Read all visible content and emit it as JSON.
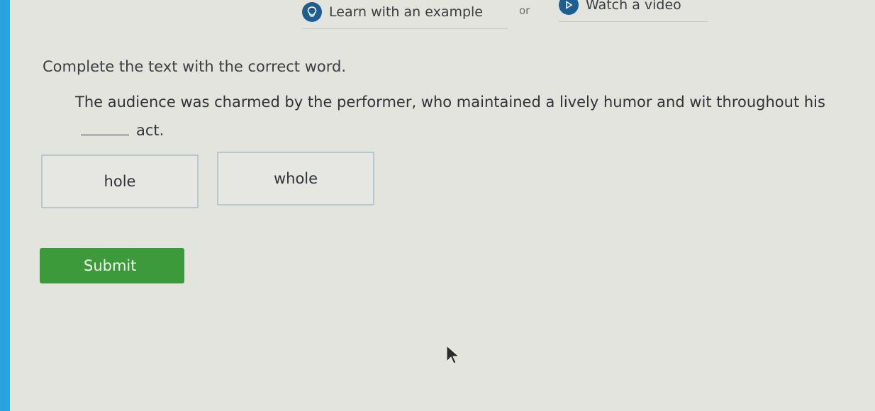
{
  "nav": {
    "learn_label": "Learn with an example",
    "learn_icon": "lightbulb-icon",
    "or_label": "or",
    "video_label": "Watch a video",
    "video_icon": "play-icon"
  },
  "question": {
    "instruction": "Complete the text with the correct word.",
    "sentence_before": "The audience was charmed by the performer, who maintained a lively humor and wit throughout his",
    "sentence_after": "act."
  },
  "choices": [
    {
      "label": "hole"
    },
    {
      "label": "whole"
    }
  ],
  "submit_label": "Submit",
  "colors": {
    "accent_blue": "#2aa3dd",
    "icon_circle": "#1f5f8f",
    "submit_green": "#3c9a3a",
    "background": "#e4e4df"
  }
}
